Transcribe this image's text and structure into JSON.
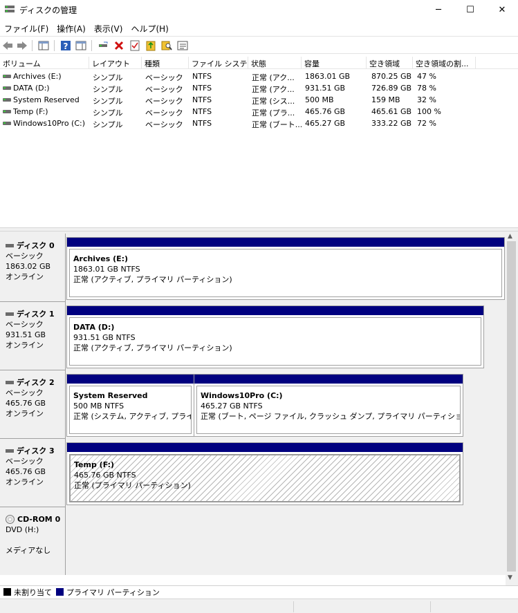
{
  "window": {
    "title": "ディスクの管理",
    "controls": [
      "─",
      "☐",
      "✕"
    ]
  },
  "menu": [
    "ファイル(F)",
    "操作(A)",
    "表示(V)",
    "ヘルプ(H)"
  ],
  "volume_list": {
    "columns": [
      "ボリューム",
      "レイアウト",
      "種類",
      "ファイル システム",
      "状態",
      "容量",
      "空き領域",
      "空き領域の割..."
    ],
    "rows": [
      [
        "Archives (E:)",
        "シンプル",
        "ベーシック",
        "NTFS",
        "正常 (アク...",
        "1863.01 GB",
        "870.25 GB",
        "47 %"
      ],
      [
        "DATA (D:)",
        "シンプル",
        "ベーシック",
        "NTFS",
        "正常 (アク...",
        "931.51 GB",
        "726.89 GB",
        "78 %"
      ],
      [
        "System Reserved",
        "シンプル",
        "ベーシック",
        "NTFS",
        "正常 (シス...",
        "500 MB",
        "159 MB",
        "32 %"
      ],
      [
        "Temp (F:)",
        "シンプル",
        "ベーシック",
        "NTFS",
        "正常 (プラ...",
        "465.76 GB",
        "465.61 GB",
        "100 %"
      ],
      [
        "Windows10Pro (C:)",
        "シンプル",
        "ベーシック",
        "NTFS",
        "正常 (ブート...",
        "465.27 GB",
        "333.22 GB",
        "72 %"
      ]
    ]
  },
  "disks": [
    {
      "name": "ディスク 0",
      "type": "ベーシック",
      "size": "1863.02 GB",
      "status": "オンライン",
      "partitions": [
        {
          "name": "Archives  (E:)",
          "size": "1863.01 GB NTFS",
          "status": "正常 (アクティブ, プライマリ パーティション)"
        }
      ]
    },
    {
      "name": "ディスク 1",
      "type": "ベーシック",
      "size": "931.51 GB",
      "status": "オンライン",
      "partitions": [
        {
          "name": "DATA  (D:)",
          "size": "931.51 GB NTFS",
          "status": "正常 (アクティブ, プライマリ パーティション)"
        }
      ]
    },
    {
      "name": "ディスク 2",
      "type": "ベーシック",
      "size": "465.76 GB",
      "status": "オンライン",
      "partitions": [
        {
          "name": "System Reserved",
          "size": "500 MB NTFS",
          "status": "正常 (システム, アクティブ, プライマリ"
        },
        {
          "name": "Windows10Pro  (C:)",
          "size": "465.27 GB NTFS",
          "status": "正常 (ブート, ページ ファイル, クラッシュ ダンプ, プライマリ パーティション)"
        }
      ]
    },
    {
      "name": "ディスク 3",
      "type": "ベーシック",
      "size": "465.76 GB",
      "status": "オンライン",
      "partitions": [
        {
          "name": "Temp  (F:)",
          "size": "465.76 GB NTFS",
          "status": "正常 (プライマリ パーティション)"
        }
      ]
    }
  ],
  "cdrom": {
    "name": "CD-ROM 0",
    "drive": "DVD (H:)",
    "media": "メディアなし"
  },
  "legend": [
    {
      "label": "未割り当て",
      "color": "#000000"
    },
    {
      "label": "プライマリ パーティション",
      "color": "#00007f"
    }
  ]
}
